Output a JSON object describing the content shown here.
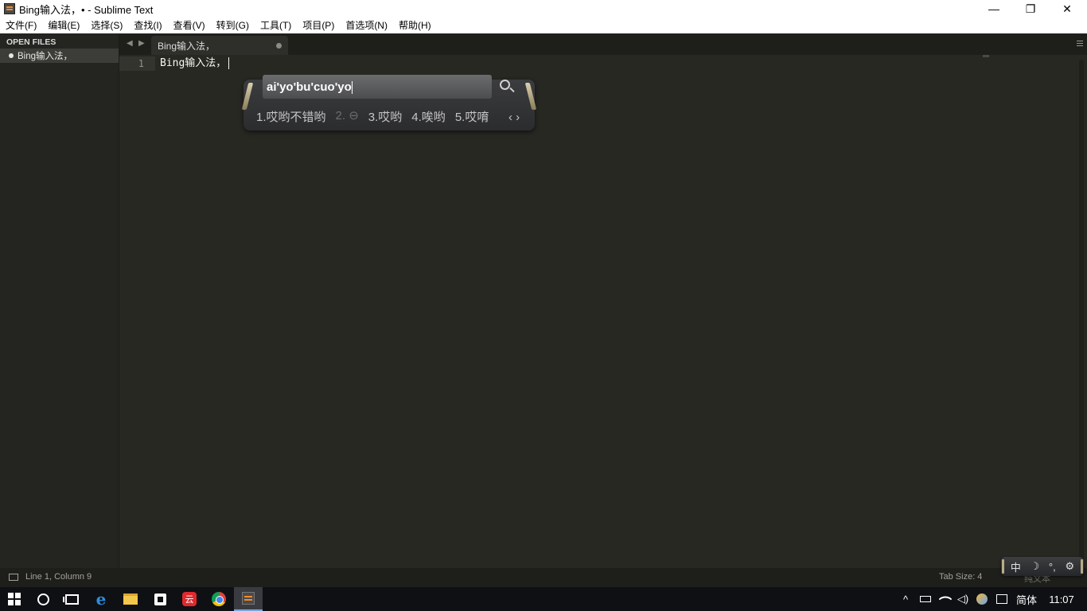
{
  "window": {
    "title": "Bing输入法，• - Sublime Text",
    "minimize": "—",
    "restore": "❐",
    "close": "✕"
  },
  "menu": [
    "文件(F)",
    "编辑(E)",
    "选择(S)",
    "查找(I)",
    "查看(V)",
    "转到(G)",
    "工具(T)",
    "项目(P)",
    "首选项(N)",
    "帮助(H)"
  ],
  "sidebar": {
    "header": "OPEN FILES",
    "files": [
      "Bing输入法，"
    ]
  },
  "tabs": {
    "prev": "◀",
    "next": "▶",
    "active_label": "Bing输入法，"
  },
  "editor": {
    "line_number": "1",
    "line_text": "Bing输入法，"
  },
  "ime": {
    "input": "ai'yo'bu'cuo'yo",
    "candidates": [
      "1.哎哟不错哟",
      "2.",
      "3.哎哟",
      "4.唉哟",
      "5.哎唷"
    ],
    "pager": "‹ ›"
  },
  "statusbar": {
    "position": "Line 1, Column 9",
    "tab_size": "Tab Size: 4",
    "syntax": "纯文本"
  },
  "imebar": {
    "lang": "中",
    "moon": "☽",
    "punct": "°,",
    "gear": "⚙"
  },
  "taskbar": {
    "edge_letter": "e",
    "netease_letter": "云",
    "tray_up": "^",
    "lang": "简体",
    "clock": "11:07"
  }
}
